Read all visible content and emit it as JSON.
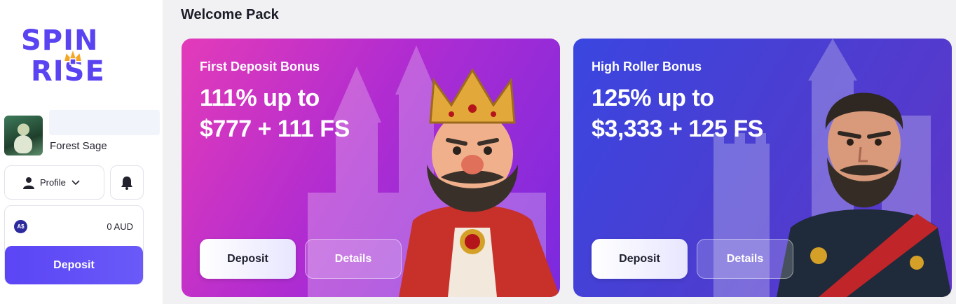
{
  "brand": {
    "line1": "SPIN",
    "line2": "RISE",
    "accent_color": "#5a43f0",
    "crown_color": "#f5a623"
  },
  "user": {
    "name": "Forest Sage",
    "avatar_icon": "wizard-avatar"
  },
  "profile": {
    "label": "Profile"
  },
  "wallet": {
    "currency_badge": "A$",
    "balance": "0 AUD",
    "deposit_label": "Deposit"
  },
  "main": {
    "section_title": "Welcome Pack",
    "cards": [
      {
        "subtitle": "First Deposit Bonus",
        "line1": "111% up to",
        "line2": "$777 + 111 FS",
        "deposit_label": "Deposit",
        "details_label": "Details"
      },
      {
        "subtitle": "High Roller Bonus",
        "line1": "125% up to",
        "line2": "$3,333 + 125 FS",
        "deposit_label": "Deposit",
        "details_label": "Details"
      }
    ]
  }
}
